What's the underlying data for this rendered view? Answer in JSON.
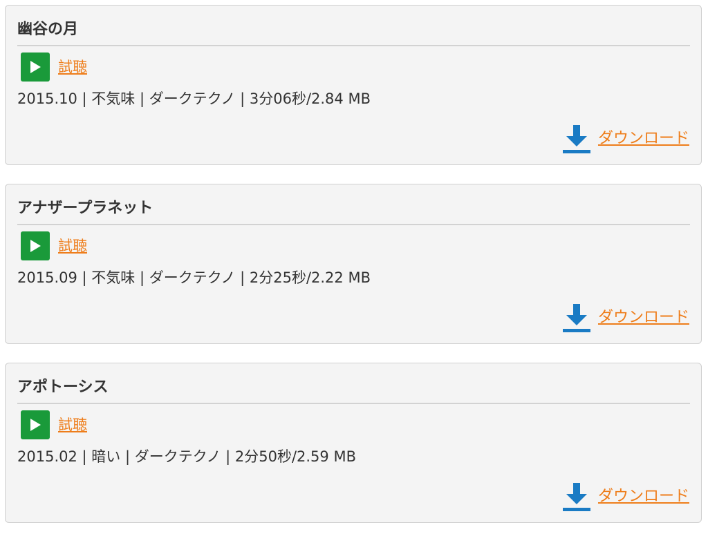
{
  "colors": {
    "card_background": "#f4f4f4",
    "card_border": "#cfcfcf",
    "title_text": "#333333",
    "link_orange": "#ee7d1a",
    "play_green": "#1a9a3a",
    "download_blue": "#1a7bc4"
  },
  "icons": {
    "play": "play-icon",
    "download": "download-icon"
  },
  "tracks": [
    {
      "title": "幽谷の月",
      "listen_label": "試聴",
      "meta": "2015.10 | 不気味 | ダークテクノ | 3分06秒/2.84 MB",
      "download_label": "ダウンロード"
    },
    {
      "title": "アナザープラネット",
      "listen_label": "試聴",
      "meta": "2015.09 | 不気味 | ダークテクノ | 2分25秒/2.22 MB",
      "download_label": "ダウンロード"
    },
    {
      "title": "アポトーシス",
      "listen_label": "試聴",
      "meta": "2015.02 | 暗い | ダークテクノ | 2分50秒/2.59 MB",
      "download_label": "ダウンロード"
    }
  ]
}
